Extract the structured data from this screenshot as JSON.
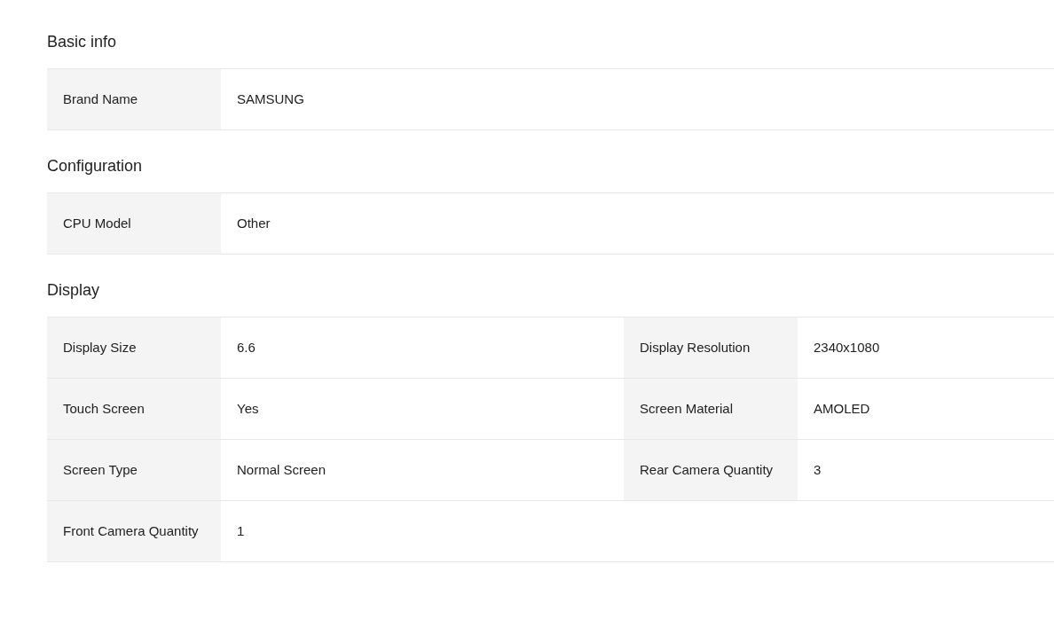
{
  "sections": [
    {
      "title": "Basic info",
      "rows": [
        [
          {
            "label": "Brand Name",
            "value": "SAMSUNG"
          }
        ]
      ]
    },
    {
      "title": "Configuration",
      "rows": [
        [
          {
            "label": "CPU Model",
            "value": "Other"
          }
        ]
      ]
    },
    {
      "title": "Display",
      "rows": [
        [
          {
            "label": "Display Size",
            "value": "6.6"
          },
          {
            "label": "Display Resolution",
            "value": "2340x1080"
          }
        ],
        [
          {
            "label": "Touch Screen",
            "value": "Yes"
          },
          {
            "label": "Screen Material",
            "value": "AMOLED"
          }
        ],
        [
          {
            "label": "Screen Type",
            "value": "Normal Screen"
          },
          {
            "label": "Rear Camera Quantity",
            "value": "3"
          }
        ],
        [
          {
            "label": "Front Camera Quantity",
            "value": "1"
          }
        ]
      ]
    }
  ]
}
